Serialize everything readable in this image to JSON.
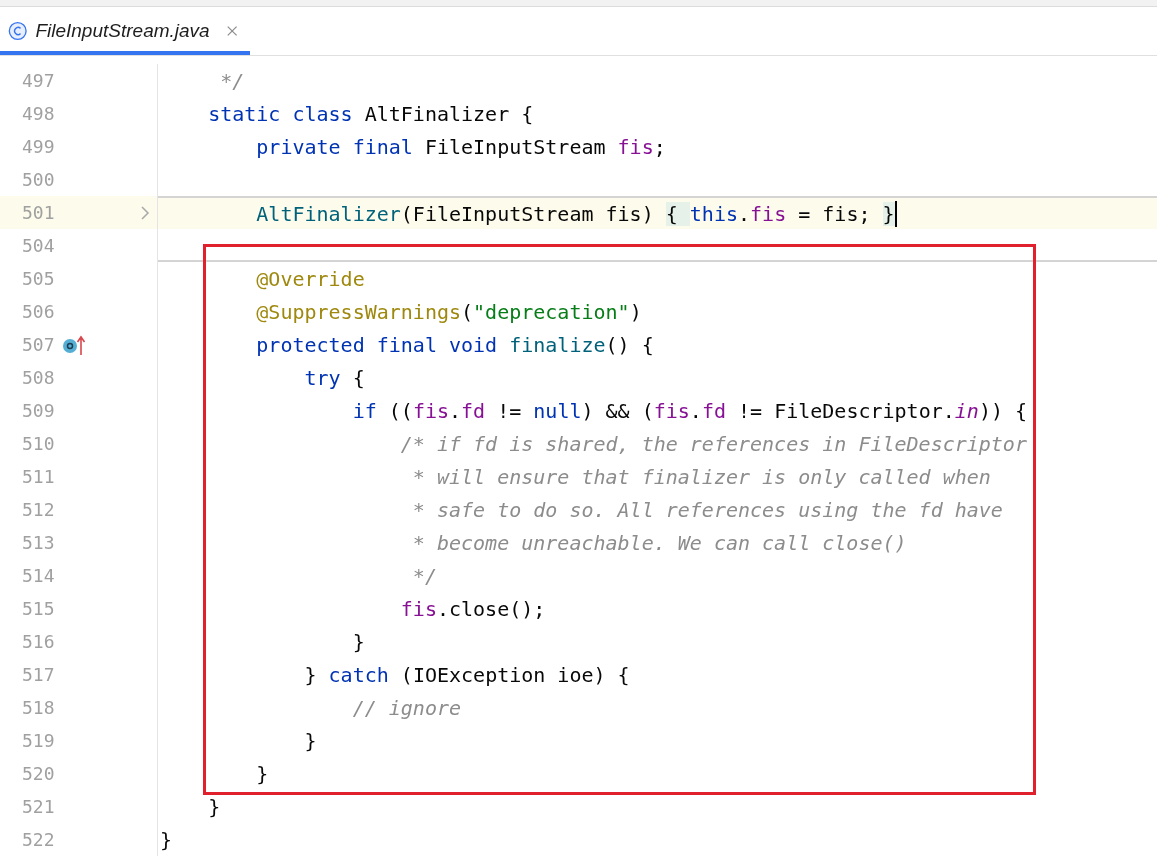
{
  "tab": {
    "title": "FileInputStream.java",
    "selected": true
  },
  "lines": [
    {
      "number": "497",
      "current": false,
      "tokens": [
        {
          "text": "     */",
          "kind": "comment"
        }
      ]
    },
    {
      "number": "498",
      "current": false,
      "tokens": [
        {
          "text": "    static class",
          "kind": "kw"
        },
        {
          "text": " AltFinalizer {",
          "kind": "plain"
        }
      ]
    },
    {
      "number": "499",
      "current": false,
      "tokens": [
        {
          "text": "        private final",
          "kind": "kw"
        },
        {
          "text": " FileInputStream ",
          "kind": "plain"
        },
        {
          "text": "fis",
          "kind": "field"
        },
        {
          "text": ";",
          "kind": "plain"
        }
      ]
    },
    {
      "number": "500",
      "current": false
    },
    {
      "number": "501",
      "current": true,
      "gutter_icon": {
        "kind": "fold"
      },
      "separator": {
        "kind": "above"
      },
      "tokens": [
        {
          "text": "        AltFinalizer",
          "kind": "method"
        },
        {
          "text": "(FileInputStream fis) ",
          "kind": "plain"
        },
        {
          "text": "{ ",
          "kind": "fold"
        },
        {
          "text": "this",
          "kind": "kw"
        },
        {
          "text": ".",
          "kind": "plain"
        },
        {
          "text": "fis",
          "kind": "field"
        },
        {
          "text": " = fis; ",
          "kind": "plain"
        },
        {
          "text": "}",
          "kind": "fold"
        }
      ]
    },
    {
      "number": "504",
      "current": false,
      "separator": {
        "kind": "below"
      }
    },
    {
      "number": "505",
      "current": false,
      "tokens": [
        {
          "text": "        @Override",
          "kind": "annot"
        }
      ]
    },
    {
      "number": "506",
      "current": false,
      "tokens": [
        {
          "text": "        @SuppressWarnings",
          "kind": "annot"
        },
        {
          "text": "(",
          "kind": "plain"
        },
        {
          "text": "\"deprecation\"",
          "kind": "string"
        },
        {
          "text": ")",
          "kind": "plain"
        }
      ]
    },
    {
      "number": "507",
      "current": false,
      "gutter_icon": {
        "kind": "overrides"
      },
      "tokens": [
        {
          "text": "        protected final void",
          "kind": "kw"
        },
        {
          "text": " finalize",
          "kind": "method"
        },
        {
          "text": "() {",
          "kind": "plain"
        }
      ]
    },
    {
      "number": "508",
      "current": false,
      "tokens": [
        {
          "text": "            try",
          "kind": "kw"
        },
        {
          "text": " {",
          "kind": "plain"
        }
      ]
    },
    {
      "number": "509",
      "current": false,
      "tokens": [
        {
          "text": "                if",
          "kind": "kw"
        },
        {
          "text": " ((",
          "kind": "plain"
        },
        {
          "text": "fis",
          "kind": "field"
        },
        {
          "text": ".",
          "kind": "plain"
        },
        {
          "text": "fd",
          "kind": "field"
        },
        {
          "text": " != ",
          "kind": "plain"
        },
        {
          "text": "null",
          "kind": "kw"
        },
        {
          "text": ") && (",
          "kind": "plain"
        },
        {
          "text": "fis",
          "kind": "field"
        },
        {
          "text": ".",
          "kind": "plain"
        },
        {
          "text": "fd",
          "kind": "field"
        },
        {
          "text": " != FileDescriptor.",
          "kind": "plain"
        },
        {
          "text": "in",
          "kind": "static"
        },
        {
          "text": ")) {",
          "kind": "plain"
        }
      ]
    },
    {
      "number": "510",
      "current": false,
      "tokens": [
        {
          "text": "                    /* if fd is shared, the references in FileDescriptor",
          "kind": "comment"
        }
      ]
    },
    {
      "number": "511",
      "current": false,
      "tokens": [
        {
          "text": "                     * will ensure that finalizer is only called when",
          "kind": "comment"
        }
      ]
    },
    {
      "number": "512",
      "current": false,
      "tokens": [
        {
          "text": "                     * safe to do so. All references using the fd have",
          "kind": "comment"
        }
      ]
    },
    {
      "number": "513",
      "current": false,
      "tokens": [
        {
          "text": "                     * become unreachable. We can call close()",
          "kind": "comment"
        }
      ]
    },
    {
      "number": "514",
      "current": false,
      "tokens": [
        {
          "text": "                     */",
          "kind": "comment"
        }
      ]
    },
    {
      "number": "515",
      "current": false,
      "tokens": [
        {
          "text": "                    fis",
          "kind": "field"
        },
        {
          "text": ".close();",
          "kind": "plain"
        }
      ]
    },
    {
      "number": "516",
      "current": false,
      "tokens": [
        {
          "text": "                }",
          "kind": "plain"
        }
      ]
    },
    {
      "number": "517",
      "current": false,
      "tokens": [
        {
          "text": "            } ",
          "kind": "plain"
        },
        {
          "text": "catch",
          "kind": "kw"
        },
        {
          "text": " (IOException ioe) {",
          "kind": "plain"
        }
      ]
    },
    {
      "number": "518",
      "current": false,
      "tokens": [
        {
          "text": "                // ignore",
          "kind": "comment"
        }
      ]
    },
    {
      "number": "519",
      "current": false,
      "tokens": [
        {
          "text": "            }",
          "kind": "plain"
        }
      ]
    },
    {
      "number": "520",
      "current": false,
      "tokens": [
        {
          "text": "        }",
          "kind": "plain"
        }
      ]
    },
    {
      "number": "521",
      "current": false,
      "tokens": [
        {
          "text": "    }",
          "kind": "plain"
        }
      ]
    },
    {
      "number": "522",
      "current": false,
      "tokens": [
        {
          "text": "}",
          "kind": "plain"
        }
      ]
    }
  ]
}
